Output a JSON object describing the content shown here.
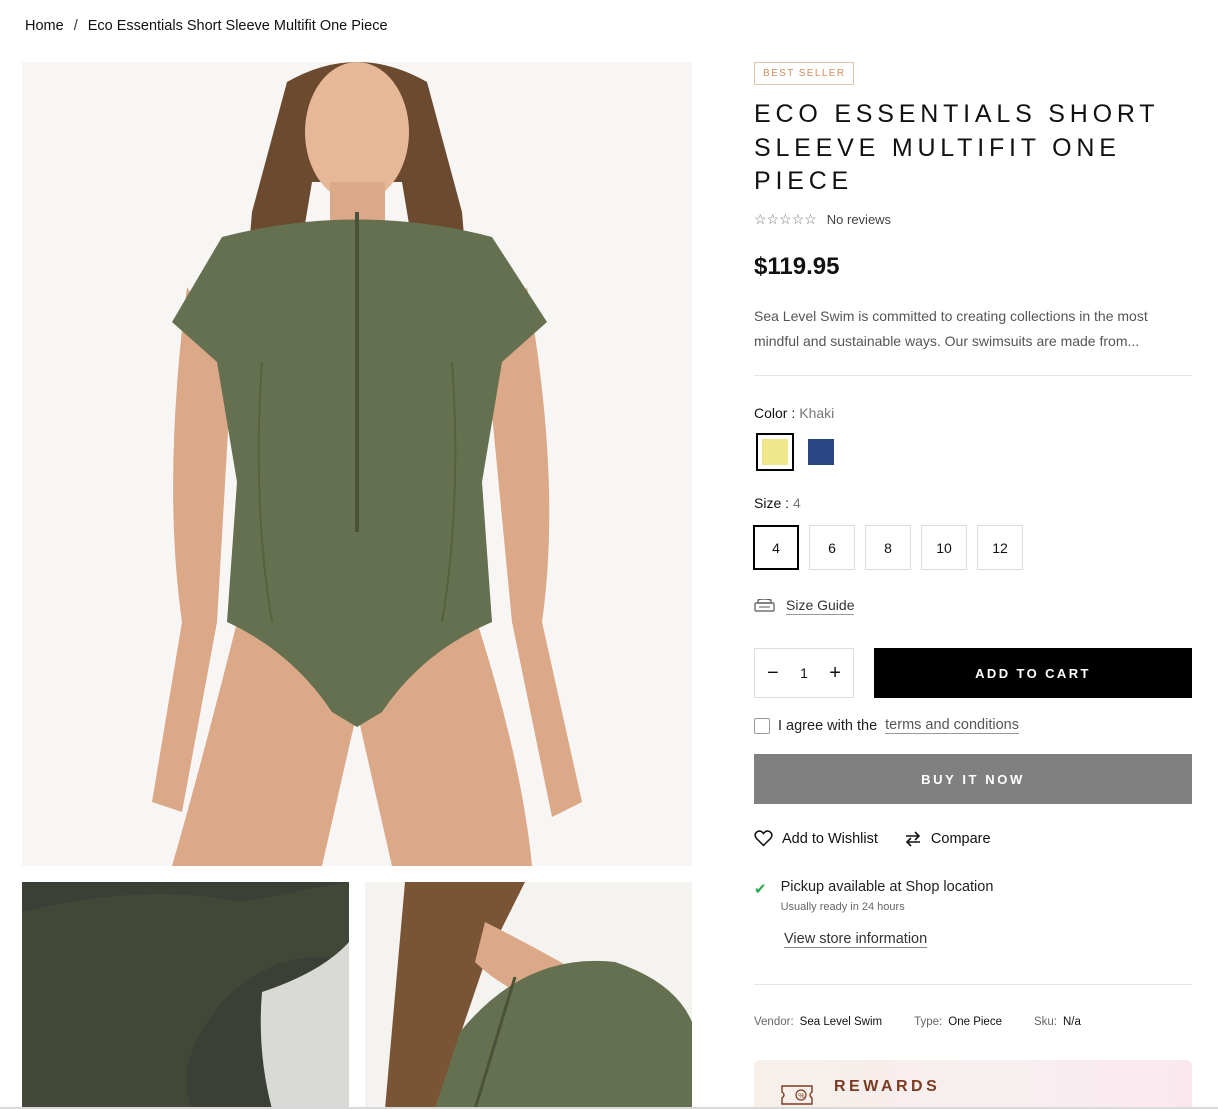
{
  "breadcrumb": {
    "home": "Home",
    "separator": "/",
    "current": "Eco Essentials Short Sleeve Multifit One Piece"
  },
  "product": {
    "badge": "BEST SELLER",
    "title": "ECO ESSENTIALS SHORT SLEEVE MULTIFIT ONE PIECE",
    "stars": "☆☆☆☆☆",
    "reviews": "No reviews",
    "price": "$119.95",
    "description": "Sea Level Swim is committed to creating collections in the most mindful and sustainable ways. Our swimsuits are made from..."
  },
  "color": {
    "label": "Color :",
    "selected": "Khaki",
    "options": [
      {
        "name": "Khaki",
        "hex": "#f0e68c"
      },
      {
        "name": "Navy",
        "hex": "#2b4584"
      }
    ]
  },
  "size": {
    "label": "Size :",
    "selected": "4",
    "options": [
      "4",
      "6",
      "8",
      "10",
      "12"
    ]
  },
  "size_guide": {
    "label": "Size Guide"
  },
  "quantity": {
    "value": "1",
    "minus": "−",
    "plus": "+"
  },
  "buttons": {
    "add_to_cart": "ADD TO CART",
    "buy_now": "BUY IT NOW"
  },
  "agree": {
    "text": "I agree with the",
    "link": "terms and conditions"
  },
  "actions": {
    "wishlist": "Add to Wishlist",
    "compare": "Compare"
  },
  "pickup": {
    "title": "Pickup available at Shop location",
    "subtitle": "Usually ready in 24 hours",
    "store_link": "View store information"
  },
  "meta": {
    "vendor_label": "Vendor:",
    "vendor": "Sea Level Swim",
    "type_label": "Type:",
    "type": "One Piece",
    "sku_label": "Sku:",
    "sku": "N/a"
  },
  "rewards": {
    "title": "REWARDS"
  },
  "colors": {
    "accent_badge": "#d58b5b",
    "pickup_check": "#2aa853",
    "buy_now_bg": "#808080"
  }
}
